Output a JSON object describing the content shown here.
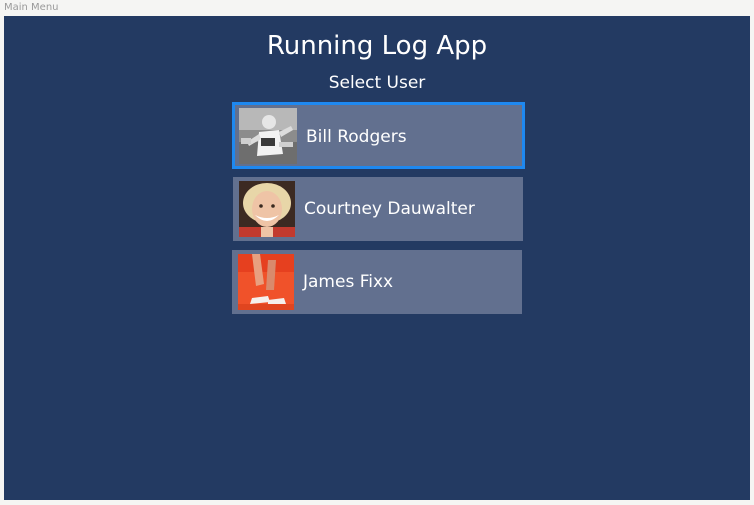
{
  "window": {
    "title": "Main Menu"
  },
  "app": {
    "title": "Running Log App",
    "subtitle": "Select User",
    "background_color": "#233a62",
    "card_color": "#62708f",
    "selection_color": "#1e88f0"
  },
  "users": [
    {
      "name": "Bill Rodgers",
      "selected": true,
      "avatar": "runner-photo-grayscale"
    },
    {
      "name": "Courtney Dauwalter",
      "selected": false,
      "avatar": "smiling-runner-photo"
    },
    {
      "name": "James Fixx",
      "selected": false,
      "avatar": "running-legs-orange-photo"
    }
  ]
}
